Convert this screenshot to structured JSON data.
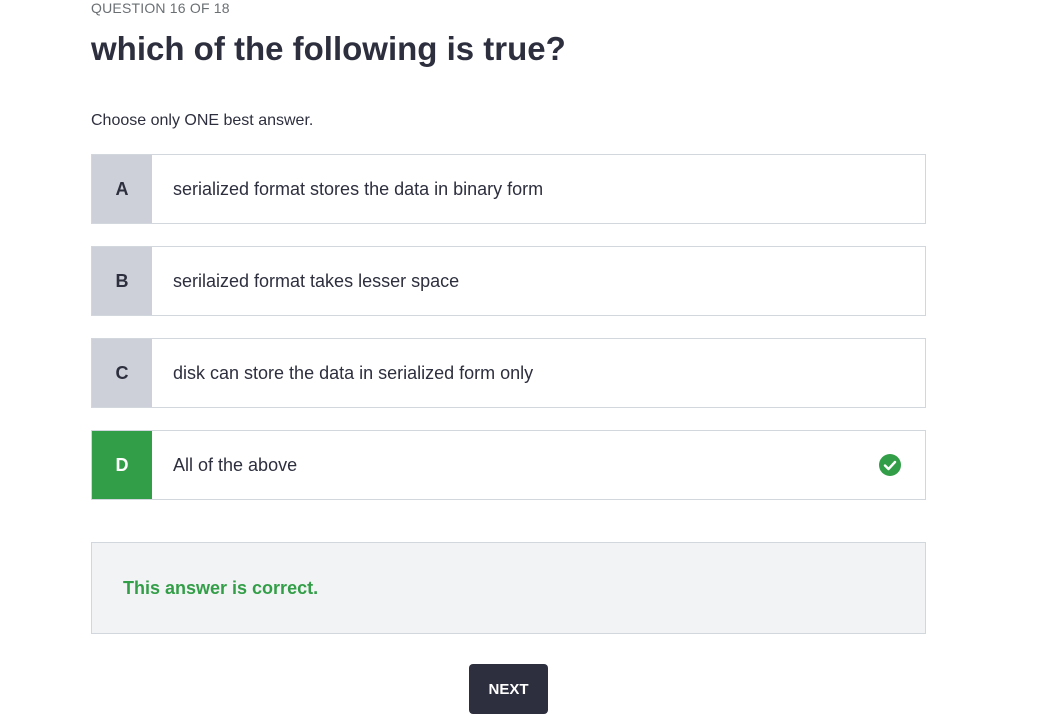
{
  "quiz": {
    "counter": "QUESTION 16 OF 18",
    "question": "which of the following is true?",
    "instruction": "Choose only ONE best answer.",
    "options": [
      {
        "letter": "A",
        "text": "serialized format stores the data in binary form",
        "selected": false
      },
      {
        "letter": "B",
        "text": "serilaized format takes lesser space",
        "selected": false
      },
      {
        "letter": "C",
        "text": "disk can store the data in serialized form only",
        "selected": false
      },
      {
        "letter": "D",
        "text": "All of the above",
        "selected": true,
        "status_icon": "check-circle-icon"
      }
    ],
    "feedback": "This answer is correct.",
    "next_label": "NEXT"
  },
  "colors": {
    "correct": "#339e48",
    "letter_bg": "#cdd0d8",
    "button_bg": "#2d2f3e",
    "feedback_bg": "#f2f3f5"
  }
}
